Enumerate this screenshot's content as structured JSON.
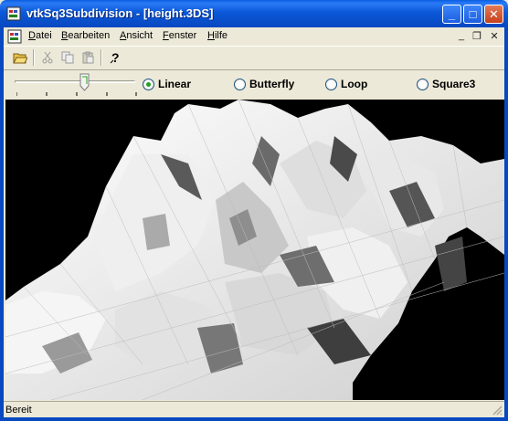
{
  "window": {
    "title": "vtkSq3Subdivision - [height.3DS]",
    "min_glyph": "_",
    "max_glyph": "□",
    "close_glyph": "✕",
    "icon": "vtk-app-icon"
  },
  "menu": {
    "items": [
      {
        "pre": "",
        "u": "D",
        "post": "atei"
      },
      {
        "pre": "",
        "u": "B",
        "post": "earbeiten"
      },
      {
        "pre": "",
        "u": "A",
        "post": "nsicht"
      },
      {
        "pre": "",
        "u": "F",
        "post": "enster"
      },
      {
        "pre": "",
        "u": "H",
        "post": "ilfe"
      }
    ],
    "mdi_min": "_",
    "mdi_restore": "❐",
    "mdi_close": "✕"
  },
  "toolbar": {
    "icons": [
      "open-folder-icon",
      "cut-icon",
      "copy-icon",
      "paste-icon",
      "help-icon"
    ]
  },
  "controls": {
    "slider_level": 0.6,
    "radios": [
      {
        "label": "Linear",
        "checked": true
      },
      {
        "label": "Butterfly",
        "checked": false
      },
      {
        "label": "Loop",
        "checked": false
      },
      {
        "label": "Square3",
        "checked": false
      }
    ]
  },
  "viewport": {
    "background": "#000000",
    "surface_color": "#e8e8e8"
  },
  "status": {
    "text": "Bereit"
  }
}
